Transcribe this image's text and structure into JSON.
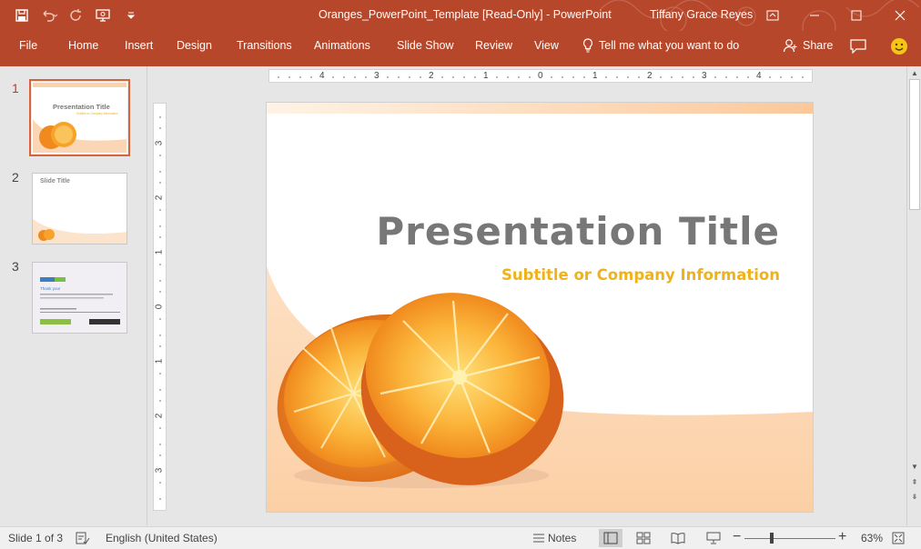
{
  "window": {
    "doc_title": "Oranges_PowerPoint_Template [Read-Only]  -  PowerPoint",
    "user": "Tiffany Grace Reyes",
    "accent_color": "#b7472a"
  },
  "quick_access": {
    "icons": [
      "save-icon",
      "undo-icon",
      "redo-icon",
      "present-icon",
      "customize-icon"
    ]
  },
  "ribbon": {
    "tabs": [
      "File",
      "Home",
      "Insert",
      "Design",
      "Transitions",
      "Animations",
      "Slide Show",
      "Review",
      "View"
    ],
    "tell_me": "Tell me what you want to do",
    "share": "Share"
  },
  "thumbnails": [
    {
      "number": "1",
      "title": "Presentation Title",
      "subtitle": "Subtitle or Company Information"
    },
    {
      "number": "2",
      "title": "Slide Title"
    },
    {
      "number": "3",
      "title": "Thank you!"
    }
  ],
  "ruler": {
    "horizontal": [
      "4",
      "3",
      "2",
      "1",
      "0",
      "1",
      "2",
      "3",
      "4"
    ],
    "vertical": [
      "3",
      "2",
      "1",
      "0",
      "1",
      "2",
      "3"
    ]
  },
  "slide": {
    "title": "Presentation Title",
    "subtitle": "Subtitle or Company Information",
    "title_color": "#777777",
    "subtitle_color": "#f0b21b"
  },
  "status": {
    "slide_count": "Slide 1 of 3",
    "language": "English (United States)",
    "notes": "Notes",
    "zoom": "63%",
    "zoom_fraction": 0.63
  }
}
